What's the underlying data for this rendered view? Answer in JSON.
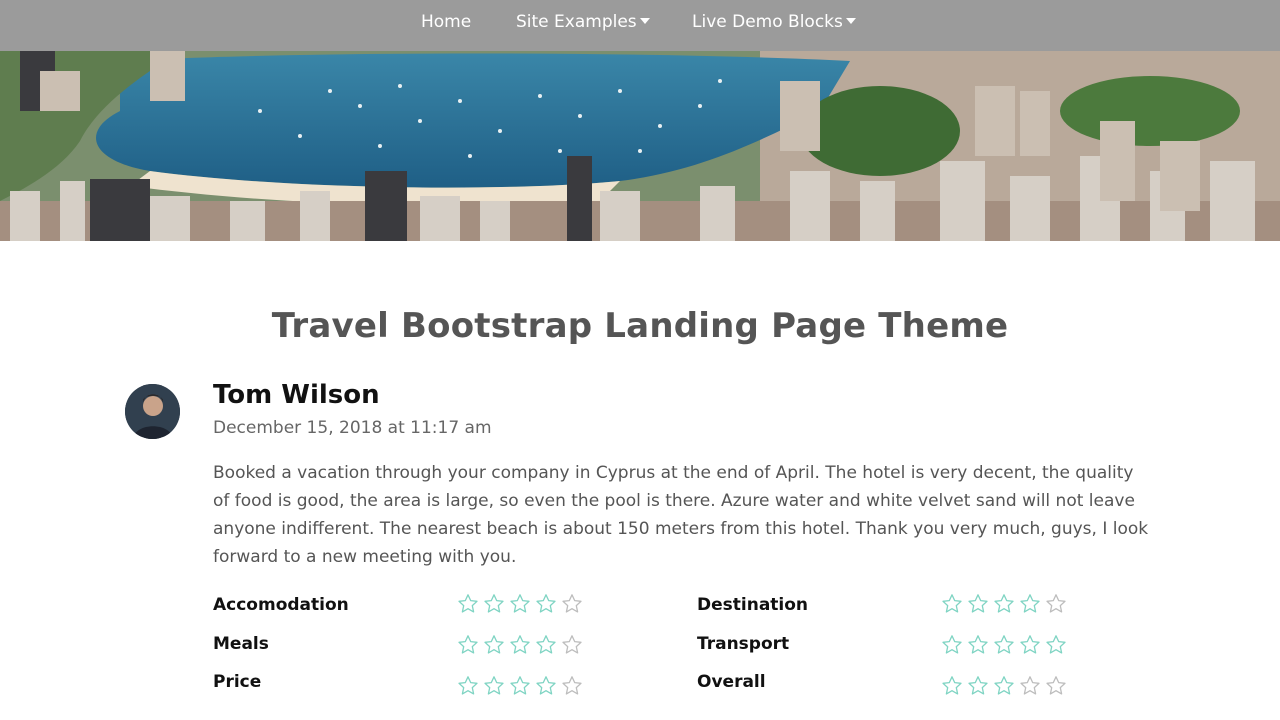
{
  "nav": {
    "items": [
      {
        "label": "Home",
        "dropdown": false
      },
      {
        "label": "Site Examples",
        "dropdown": true
      },
      {
        "label": "Live Demo Blocks",
        "dropdown": true
      }
    ]
  },
  "page": {
    "title": "Travel Bootstrap Landing Page Theme"
  },
  "review": {
    "name": "Tom Wilson",
    "date": "December 15, 2018 at 11:17 am",
    "text": "Booked a vacation through your company in Cyprus at the end of April. The hotel is very decent, the quality of food is good, the area is large, so even the pool is there. Azure water and white velvet sand will not leave anyone indifferent. The nearest beach is about 150 meters from this hotel. Thank you very much, guys, I look forward to a new meeting with you.",
    "ratings": [
      {
        "label": "Accomodation",
        "stars": 5,
        "filled": 4
      },
      {
        "label": "Destination",
        "stars": 5,
        "filled": 4
      },
      {
        "label": "Meals",
        "stars": 5,
        "filled": 4
      },
      {
        "label": "Transport",
        "stars": 5,
        "filled": 5
      },
      {
        "label": "Price",
        "stars": 5,
        "filled": 4
      },
      {
        "label": "Overall",
        "stars": 5,
        "filled": 3
      }
    ]
  },
  "colors": {
    "navbar": "#9b9b9b",
    "star_filled": "#7fd4c3",
    "star_empty": "#bdbdbd"
  }
}
